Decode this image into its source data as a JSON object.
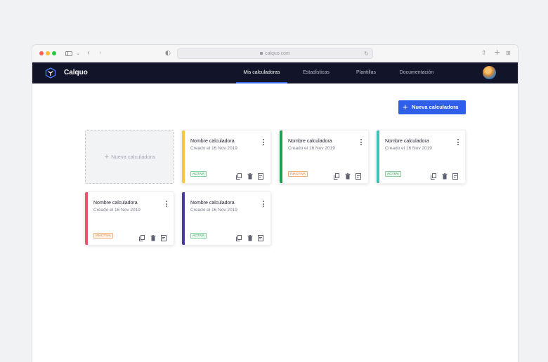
{
  "browser": {
    "url": "calquo.com"
  },
  "app": {
    "brand": "Calquo",
    "nav": [
      {
        "label": "Mis calculadoras",
        "active": true
      },
      {
        "label": "Estadísticas",
        "active": false
      },
      {
        "label": "Plantillas",
        "active": false
      },
      {
        "label": "Documentación",
        "active": false
      }
    ]
  },
  "actions": {
    "new_calculator": "Nueva calculadora"
  },
  "new_card": {
    "label": "Nueva calculadora"
  },
  "cards": [
    {
      "title": "Nombre calculadora",
      "created": "Creado el 16 Nov 2019",
      "status": "ACTIVA",
      "color": "#f5c842"
    },
    {
      "title": "Nombre calculadora",
      "created": "Creado el 16 Nov 2019",
      "status": "INACTIVA",
      "color": "#1fa04f"
    },
    {
      "title": "Nombre calculadora",
      "created": "Creado el 16 Nov 2019",
      "status": "ACTIVA",
      "color": "#3fc1b8"
    },
    {
      "title": "Nombre calculadora",
      "created": "Creado el 16 Nov 2019",
      "status": "INACTIVA",
      "color": "#e4566a"
    },
    {
      "title": "Nombre calculadora",
      "created": "Creado el 16 Nov 2019",
      "status": "ACTIVA",
      "color": "#4b3a9a"
    }
  ],
  "colors": {
    "nav_bg": "#121529",
    "accent": "#2f5fe8"
  }
}
